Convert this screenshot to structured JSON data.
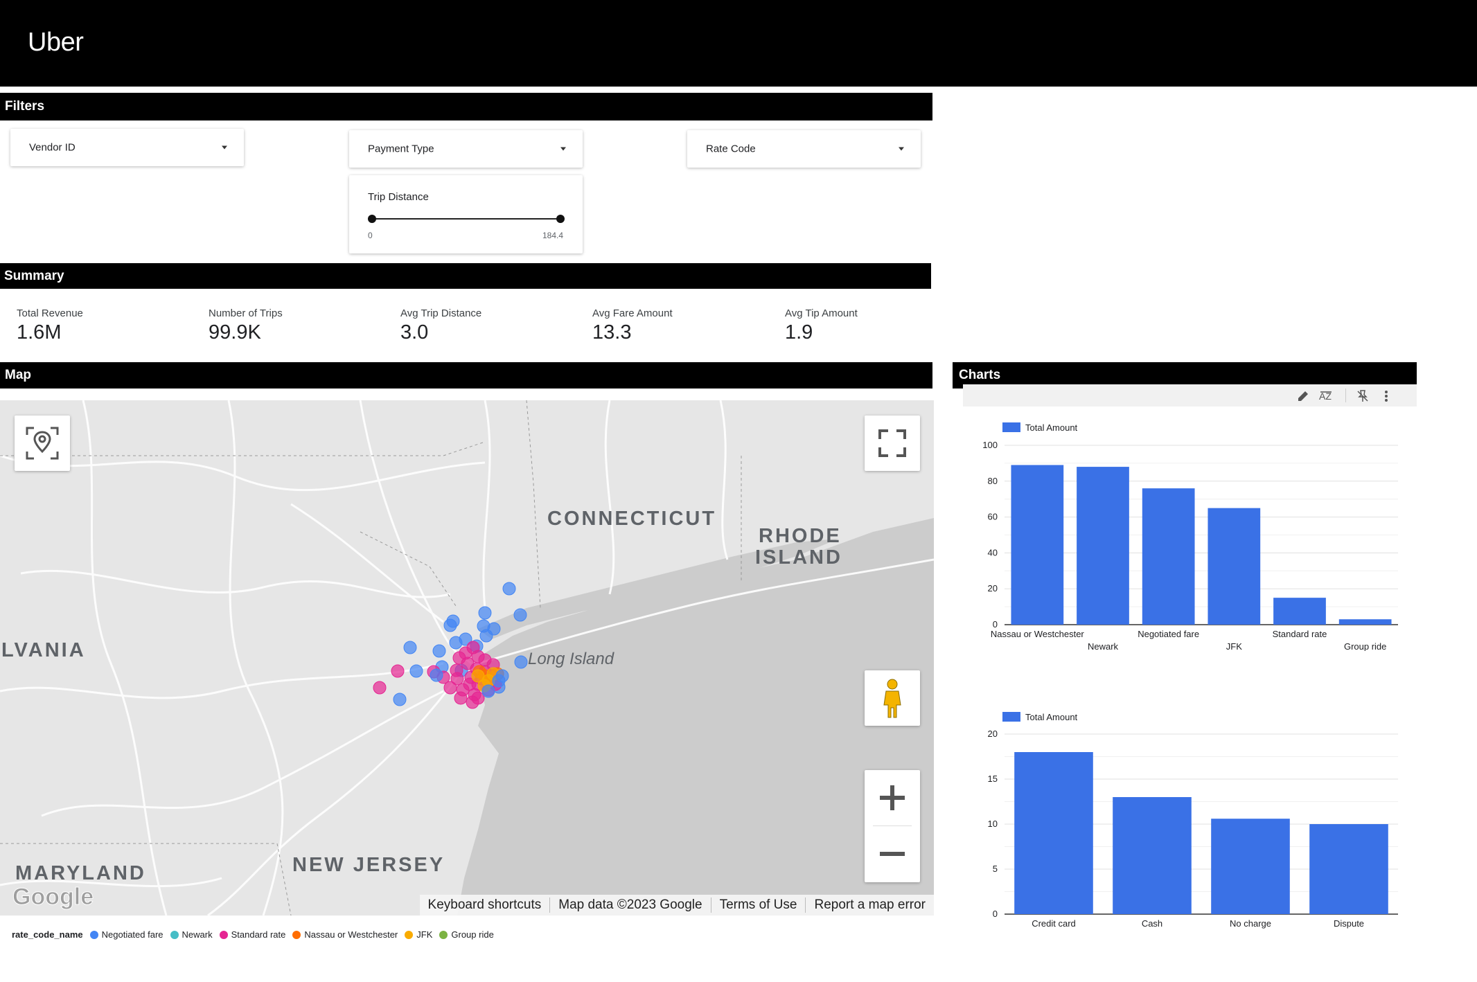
{
  "brand": "Uber",
  "sections": {
    "filters": "Filters",
    "summary": "Summary",
    "map": "Map",
    "charts": "Charts"
  },
  "filters": {
    "vendor_id": "Vendor ID",
    "payment_type": "Payment Type",
    "rate_code": "Rate Code",
    "trip_distance": {
      "label": "Trip Distance",
      "min": "0",
      "max": "184.4"
    }
  },
  "summary": {
    "total_revenue": {
      "label": "Total Revenue",
      "value": "1.6M"
    },
    "number_of_trips": {
      "label": "Number of Trips",
      "value": "99.9K"
    },
    "avg_trip_distance": {
      "label": "Avg Trip Distance",
      "value": "3.0"
    },
    "avg_fare_amount": {
      "label": "Avg Fare Amount",
      "value": "13.3"
    },
    "avg_tip_amount": {
      "label": "Avg Tip Amount",
      "value": "1.9"
    }
  },
  "map": {
    "labels": {
      "connecticut": "CONNECTICUT",
      "rhode": "RHODE",
      "island": "ISLAND",
      "pennsylvania": "LVANIA",
      "maryland": "MARYLAND",
      "new_jersey": "NEW JERSEY",
      "long_island": "Long Island"
    },
    "google_logo": "Google",
    "footer": {
      "shortcuts": "Keyboard shortcuts",
      "map_data": "Map data ©2023 Google",
      "terms": "Terms of Use",
      "report": "Report a map error"
    },
    "icons": {
      "locate": "locate-icon",
      "fullscreen": "fullscreen-icon",
      "pegman": "pegman-icon",
      "zoom_in": "zoom-in-icon",
      "zoom_out": "zoom-out-icon"
    }
  },
  "legend": {
    "title": "rate_code_name",
    "items": [
      {
        "label": "Negotiated fare",
        "color": "#4285f4"
      },
      {
        "label": "Newark",
        "color": "#46bdc6"
      },
      {
        "label": "Standard rate",
        "color": "#e52592"
      },
      {
        "label": "Nassau or Westchester",
        "color": "#ff6d01"
      },
      {
        "label": "JFK",
        "color": "#f9ab00"
      },
      {
        "label": "Group ride",
        "color": "#7cb342"
      }
    ]
  },
  "chart_toolbar": {
    "icons": [
      "edit-icon",
      "sort-az-icon",
      "pin-off-icon",
      "more-vert-icon"
    ]
  },
  "colors": {
    "bar": "#3a71e6",
    "header": "#000000"
  },
  "chart_data": [
    {
      "type": "bar",
      "categories": [
        "Nassau or Westchester",
        "Newark",
        "Negotiated fare",
        "JFK",
        "Standard rate",
        "Group ride"
      ],
      "series": [
        {
          "name": "Total Amount",
          "values": [
            89,
            88,
            76,
            65,
            15,
            3
          ]
        }
      ],
      "ylim": [
        0,
        100
      ],
      "yticks": [
        "0",
        "20",
        "40",
        "60",
        "80",
        "100"
      ],
      "legend": "top-left",
      "grid": true
    },
    {
      "type": "bar",
      "categories": [
        "Credit card",
        "Cash",
        "No charge",
        "Dispute"
      ],
      "series": [
        {
          "name": "Total Amount",
          "values": [
            18,
            13,
            10.6,
            10
          ]
        }
      ],
      "ylim": [
        0,
        20
      ],
      "yticks": [
        "0",
        "5",
        "10",
        "15",
        "20"
      ],
      "legend": "top-left",
      "grid": true
    }
  ]
}
